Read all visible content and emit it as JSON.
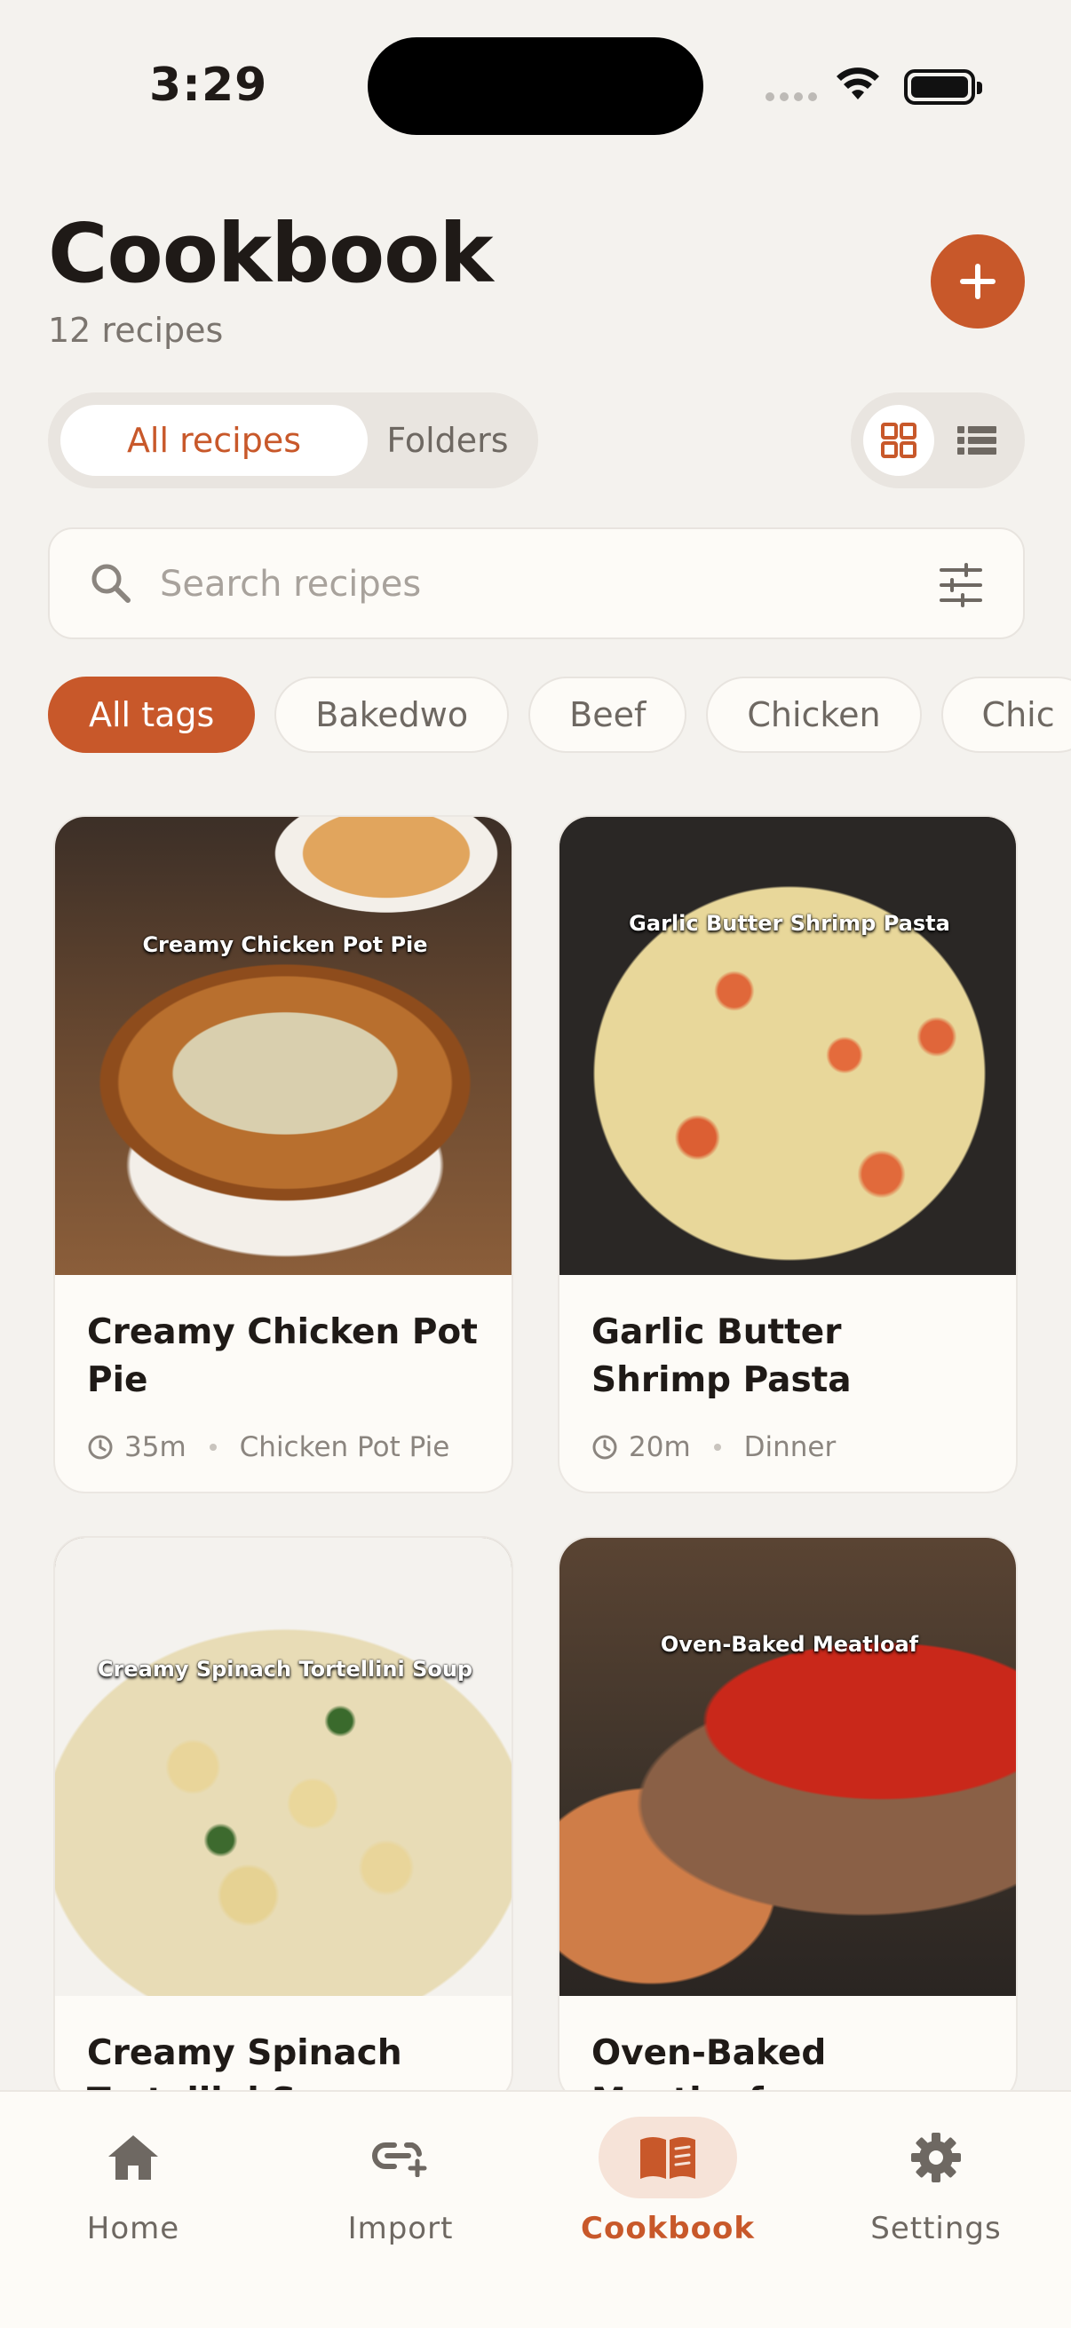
{
  "status_bar": {
    "time": "3:29"
  },
  "header": {
    "title": "Cookbook",
    "subtitle": "12 recipes",
    "add_label": "+"
  },
  "segments": {
    "active": "All recipes",
    "inactive": "Folders"
  },
  "search": {
    "placeholder": "Search recipes",
    "value": ""
  },
  "tags": [
    "All tags",
    "Bakedwo",
    "Beef",
    "Chicken",
    "Chic"
  ],
  "recipes": [
    {
      "image_caption": "Creamy Chicken Pot Pie",
      "title": "Creamy Chicken Pot Pie",
      "time": "35m",
      "tag": "Chicken Pot Pie"
    },
    {
      "image_caption": "Garlic Butter Shrimp Pasta",
      "title": "Garlic Butter Shrimp Pasta",
      "time": "20m",
      "tag": "Dinner"
    },
    {
      "image_caption": "Creamy Spinach Tortellini Soup",
      "title": "Creamy Spinach Tortellini Soup",
      "time": "",
      "tag": ""
    },
    {
      "image_caption": "Oven-Baked Meatloaf",
      "title": "Oven-Baked Meatloaf",
      "time": "",
      "tag": ""
    }
  ],
  "nav": [
    {
      "label": "Home",
      "icon": "home-icon"
    },
    {
      "label": "Import",
      "icon": "link-plus-icon"
    },
    {
      "label": "Cookbook",
      "icon": "book-icon",
      "active": true
    },
    {
      "label": "Settings",
      "icon": "gear-icon"
    }
  ],
  "colors": {
    "accent": "#c8582a",
    "background": "#f4f2ee",
    "surface": "#fdfbf7",
    "muted_text": "#7b756f"
  }
}
